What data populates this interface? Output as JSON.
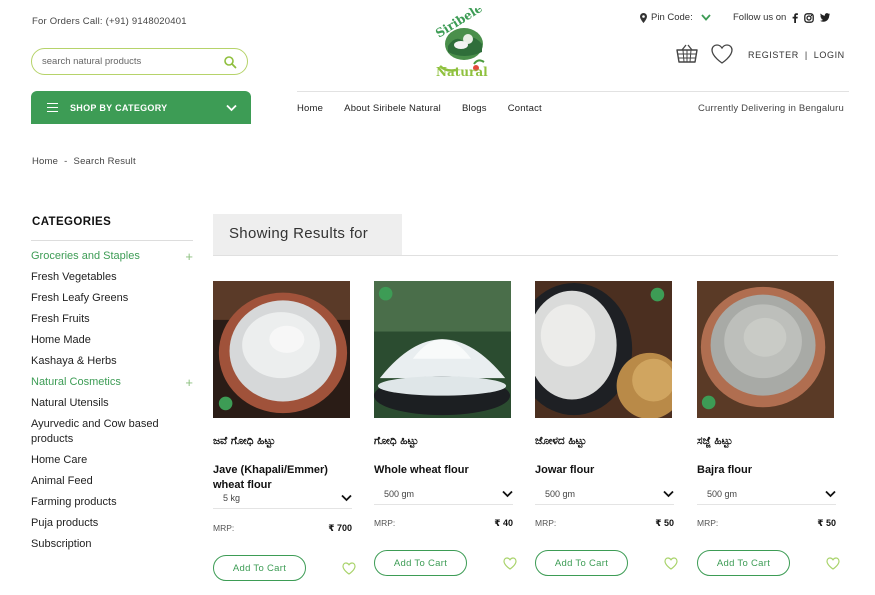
{
  "header": {
    "orders_text": "For Orders Call: (+91) 9148020401",
    "search_placeholder": "search natural products",
    "shop_by_category": "SHOP BY CATEGORY",
    "logo": {
      "brand_top": "Siribele",
      "brand_bottom": "Natural"
    },
    "pin_code_label": "Pin Code:",
    "follow_label": "Follow us on",
    "social_icons": [
      "facebook-icon",
      "instagram-icon",
      "twitter-icon"
    ],
    "register": "REGISTER",
    "separator": "|",
    "login": "LOGIN"
  },
  "nav": {
    "items": [
      "Home",
      "About Siribele Natural",
      "Blogs",
      "Contact"
    ],
    "delivering": "Currently Delivering in Bengaluru"
  },
  "breadcrumb": {
    "home": "Home",
    "sep": "-",
    "current": "Search Result"
  },
  "sidebar": {
    "title": "CATEGORIES",
    "items": [
      {
        "label": "Groceries and Staples",
        "expandable": true
      },
      {
        "label": "Fresh Vegetables"
      },
      {
        "label": "Fresh Leafy Greens"
      },
      {
        "label": "Fresh Fruits"
      },
      {
        "label": "Home Made"
      },
      {
        "label": "Kashaya & Herbs"
      },
      {
        "label": "Natural Cosmetics",
        "expandable": true
      },
      {
        "label": "Natural Utensils"
      },
      {
        "label": "Ayurvedic and Cow based products"
      },
      {
        "label": "Home Care"
      },
      {
        "label": "Animal Feed"
      },
      {
        "label": "Farming products"
      },
      {
        "label": "Puja products"
      },
      {
        "label": "Subscription"
      }
    ],
    "plus": "+"
  },
  "results": {
    "title": "Showing Results for",
    "mrp_label": "MRP:",
    "add_to_cart": "Add To Cart",
    "products": [
      {
        "kannada": "ಜವೆ ಗೋಧಿ ಹಿಟ್ಟು",
        "name": "Jave (Khapali/Emmer) wheat flour",
        "qty": "5 kg",
        "price": "₹ 700"
      },
      {
        "kannada": "ಗೋಧಿ ಹಿಟ್ಟು",
        "name": "Whole wheat flour",
        "qty": "500 gm",
        "price": "₹ 40"
      },
      {
        "kannada": "ಜೋಳದ ಹಿಟ್ಟು",
        "name": "Jowar flour",
        "qty": "500 gm",
        "price": "₹ 50"
      },
      {
        "kannada": "ಸಜ್ಜೆ ಹಿಟ್ಟು",
        "name": "Bajra flour",
        "qty": "500 gm",
        "price": "₹ 50"
      }
    ]
  },
  "colors": {
    "brand_green": "#3d9c55",
    "search_border": "#b6d36a",
    "heart": "#a9d36b"
  }
}
